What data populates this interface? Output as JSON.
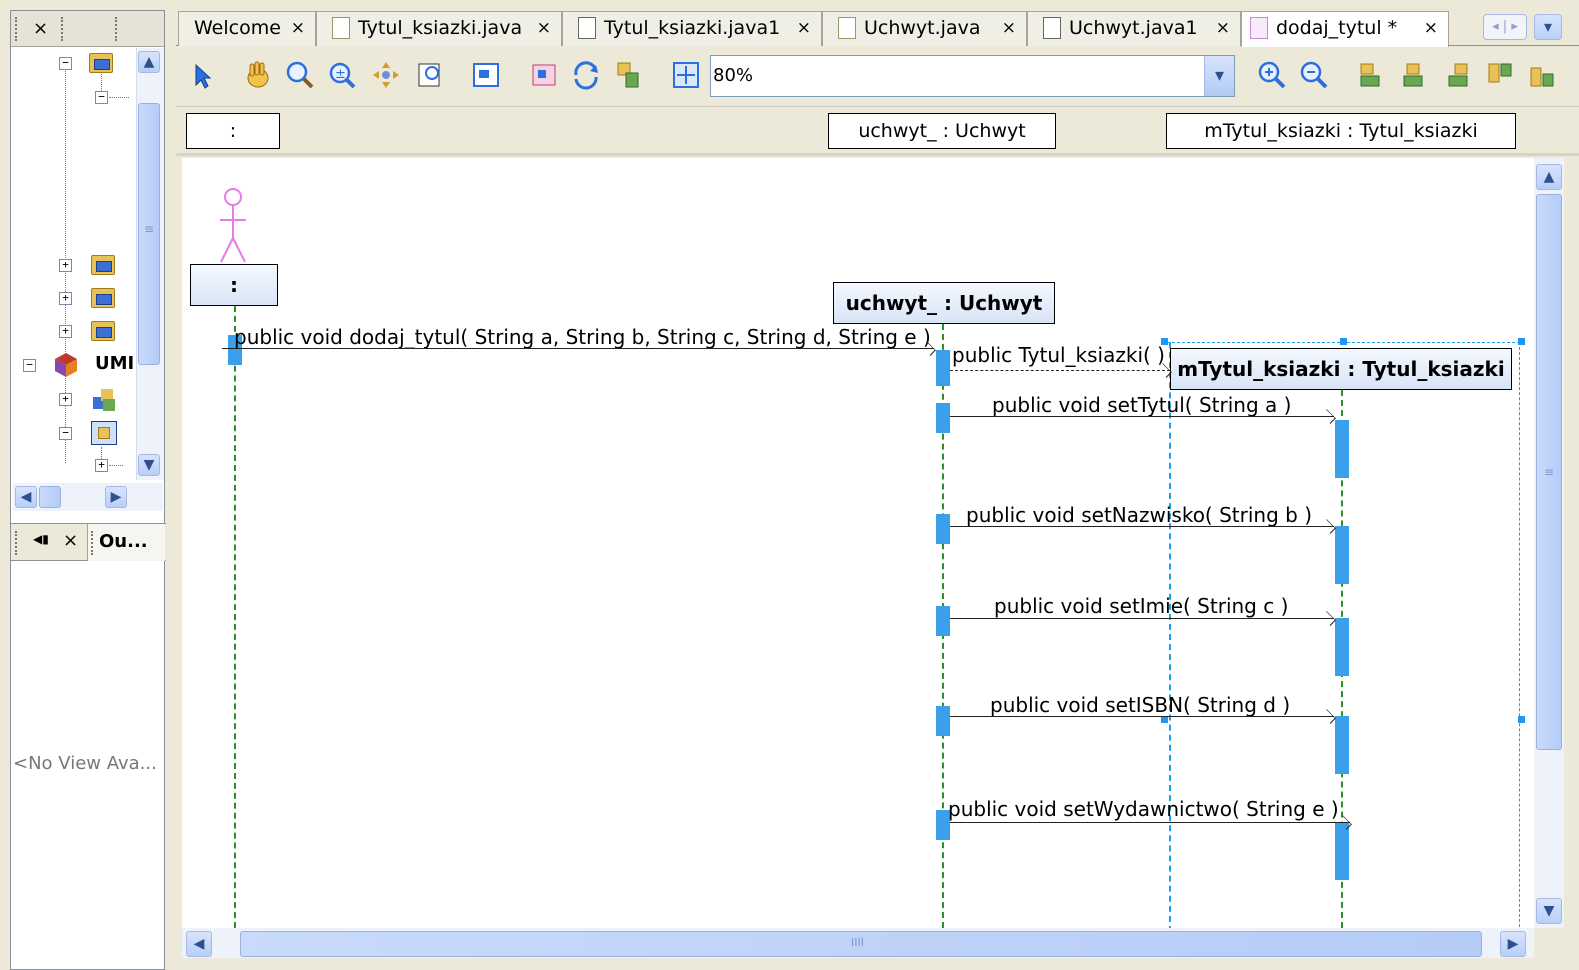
{
  "left_panel": {
    "top_tabs": {
      "close_label": "×"
    },
    "tree": {
      "uml_label": "UMI"
    },
    "bottom_tabs": {
      "outline_label": "Ou...",
      "close_label": "×",
      "speaker_label": "◀▮"
    },
    "no_view_text": "<No View Ava..."
  },
  "editor": {
    "tabs": [
      {
        "label": "Welcome",
        "close": "×"
      },
      {
        "label": "Tytul_ksiazki.java",
        "close": "×"
      },
      {
        "label": "Tytul_ksiazki.java1",
        "close": "×"
      },
      {
        "label": "Uchwyt.java",
        "close": "×"
      },
      {
        "label": "Uchwyt.java1",
        "close": "×"
      },
      {
        "label": "dodaj_tytul *",
        "close": "×"
      }
    ],
    "tab_nav": {
      "left": "◂",
      "right": "▸",
      "dropdown": "▾"
    },
    "toolbar": {
      "zoom_value": "80%",
      "zoom_dropdown": "▾"
    },
    "header_objects": [
      {
        "label": ":"
      },
      {
        "label": "uchwyt_ : Uchwyt"
      },
      {
        "label": "mTytul_ksiazki : Tytul_ksiazki"
      }
    ]
  },
  "diagram": {
    "actor_label": ":",
    "objects": [
      {
        "label": "uchwyt_ : Uchwyt"
      },
      {
        "label": "mTytul_ksiazki : Tytul_ksiazki"
      }
    ],
    "messages": [
      {
        "label": "public void  dodaj_tytul( String a, String b, String c, String d, String e )"
      },
      {
        "label": "public Tytul_ksiazki( )"
      },
      {
        "label": "public void  setTytul( String a )"
      },
      {
        "label": "public void  setNazwisko( String b )"
      },
      {
        "label": "public void  setImie( String c )"
      },
      {
        "label": "public void  setISBN( String d )"
      },
      {
        "label": "public void  setWydawnictwo( String e )"
      }
    ]
  },
  "scrollbars": {
    "up": "▲",
    "down": "▼",
    "left": "◀",
    "right": "▶",
    "grip": "≡",
    "hgrip": "IIII"
  }
}
